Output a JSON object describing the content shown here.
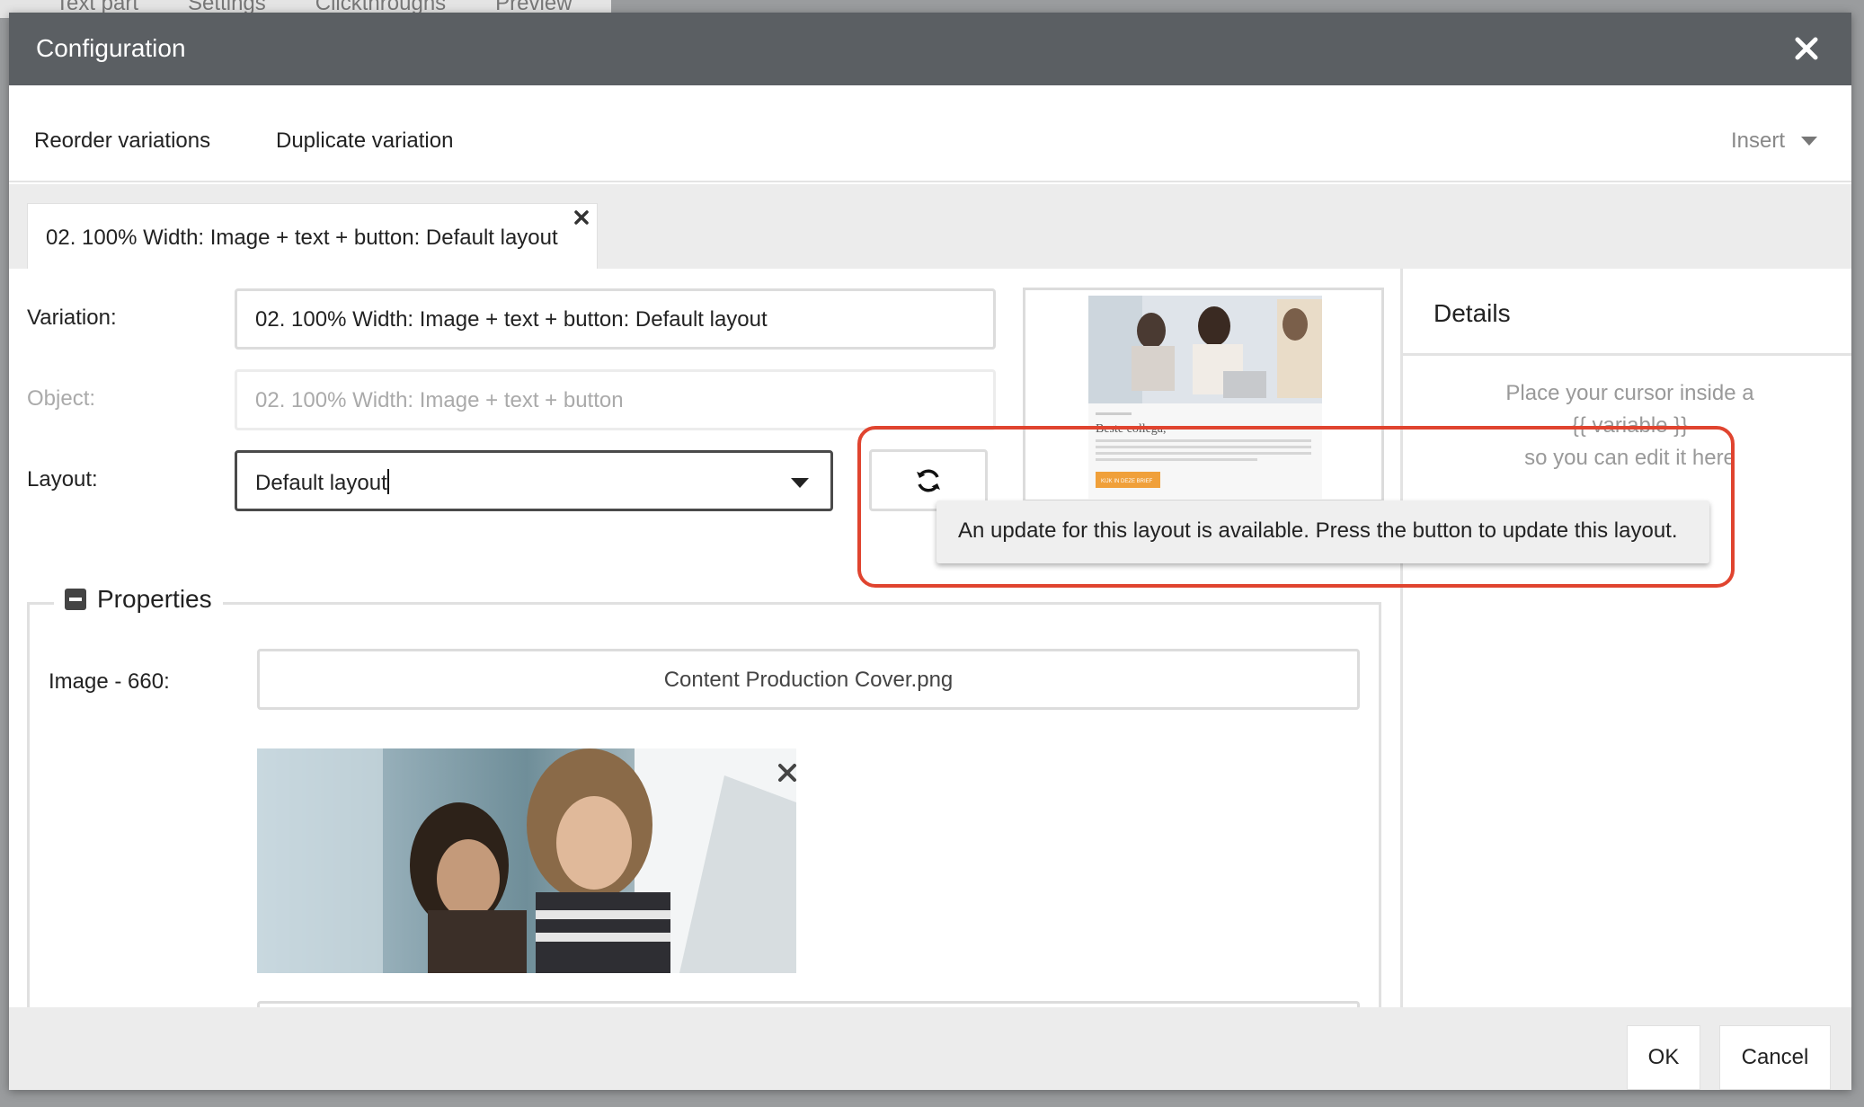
{
  "background": {
    "tabs": [
      "Text part",
      "Settings",
      "Clickthroughs",
      "Preview"
    ]
  },
  "modal": {
    "title": "Configuration",
    "close_icon": "close-icon"
  },
  "toolbar": {
    "reorder_label": "Reorder variations",
    "duplicate_label": "Duplicate variation",
    "insert_label": "Insert"
  },
  "tab": {
    "label": "02. 100% Width: Image + text + button: Default layout"
  },
  "form": {
    "variation_label": "Variation:",
    "variation_value": "02. 100% Width: Image + text + button: Default layout",
    "object_label": "Object:",
    "object_value": "02. 100% Width: Image + text + button",
    "layout_label": "Layout:",
    "layout_value": "Default layout",
    "refresh_icon": "refresh-icon",
    "tooltip": "An update for this layout is available. Press the button to update this layout."
  },
  "preview": {
    "heading": "Beste collega,",
    "button": "KIJK IN DEZE BRIEF"
  },
  "properties": {
    "legend": "Properties",
    "image_label": "Image - 660:",
    "image_file": "Content Production Cover.png"
  },
  "details": {
    "title": "Details",
    "help_line1": "Place your cursor inside a",
    "help_line2": "{{ variable }}",
    "help_line3": "so you can edit it here"
  },
  "footer": {
    "ok_label": "OK",
    "cancel_label": "Cancel"
  },
  "colors": {
    "titlebar": "#5b5f63",
    "highlight": "#e0442f"
  }
}
